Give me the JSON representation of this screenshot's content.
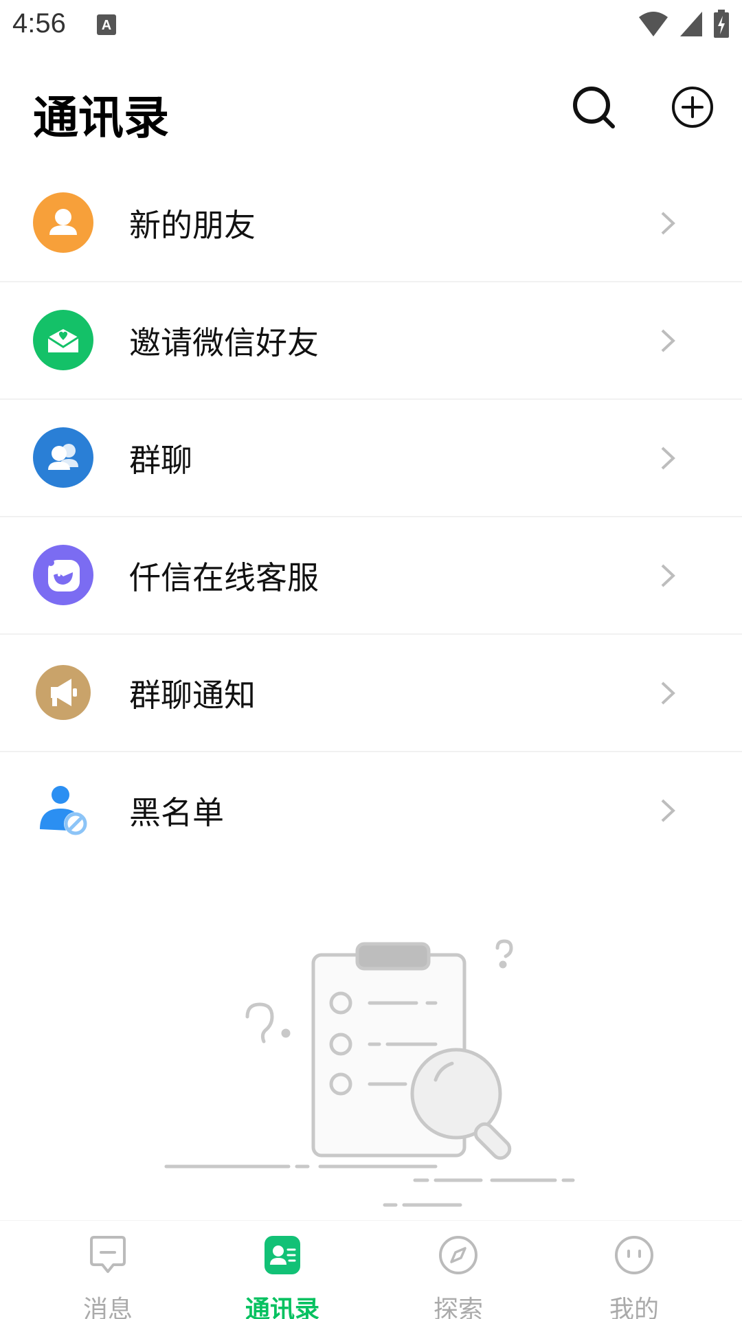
{
  "status_bar": {
    "time": "4:56"
  },
  "header": {
    "title": "通讯录"
  },
  "menu": [
    {
      "key": "new-friends",
      "label": "新的朋友",
      "icon": "person-icon",
      "color": "#f7a03a"
    },
    {
      "key": "invite-wechat",
      "label": "邀请微信好友",
      "icon": "envelope-heart-icon",
      "color": "#14c168"
    },
    {
      "key": "group-chat",
      "label": "群聊",
      "icon": "group-icon",
      "color": "#2a7fd6"
    },
    {
      "key": "online-service",
      "label": "仟信在线客服",
      "icon": "service-bird-icon",
      "color": "#7b6cf2"
    },
    {
      "key": "group-notice",
      "label": "群聊通知",
      "icon": "megaphone-icon",
      "color": "#c9a36a"
    },
    {
      "key": "blacklist",
      "label": "黑名单",
      "icon": "user-blocked-icon",
      "color": "#2b8ff2"
    }
  ],
  "tabbar": {
    "tabs": [
      {
        "label": "消息",
        "icon": "message-icon"
      },
      {
        "label": "通讯录",
        "icon": "contacts-icon",
        "active": true
      },
      {
        "label": "探索",
        "icon": "compass-icon"
      },
      {
        "label": "我的",
        "icon": "face-icon"
      }
    ],
    "active_color": "#07c160"
  }
}
